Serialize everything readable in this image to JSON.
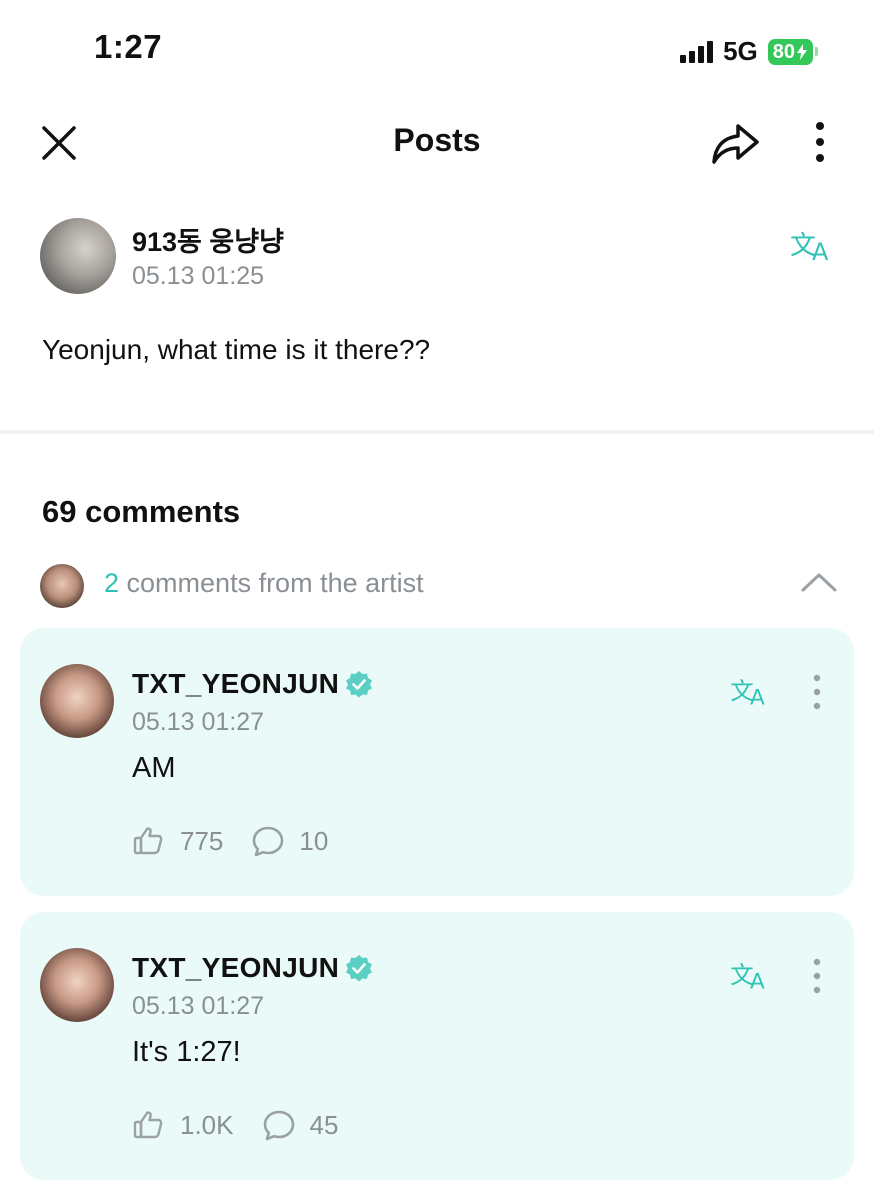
{
  "status_bar": {
    "time": "1:27",
    "network": "5G",
    "battery": "80"
  },
  "header": {
    "title": "Posts"
  },
  "post": {
    "author": "913동 웅냥냥",
    "timestamp": "05.13 01:25",
    "body": "Yeonjun, what time is it there??"
  },
  "comments": {
    "count_label": "69 comments",
    "artist_count": "2",
    "artist_label": " comments from the artist"
  },
  "artist_comments": [
    {
      "author": "TXT_YEONJUN",
      "timestamp": "05.13 01:27",
      "body": "AM",
      "likes": "775",
      "replies": "10"
    },
    {
      "author": "TXT_YEONJUN",
      "timestamp": "05.13 01:27",
      "body": "It's 1:27!",
      "likes": "1.0K",
      "replies": "45"
    }
  ],
  "colors": {
    "accent": "#2fc3b6",
    "card_bg": "#eafaf8",
    "muted": "#8a8f94",
    "battery": "#34c759"
  },
  "icons": [
    "close-icon",
    "share-icon",
    "more-vertical-icon",
    "translate-icon",
    "chevron-up-icon",
    "verified-badge-icon",
    "like-icon",
    "reply-icon",
    "signal-icon",
    "battery-icon"
  ]
}
